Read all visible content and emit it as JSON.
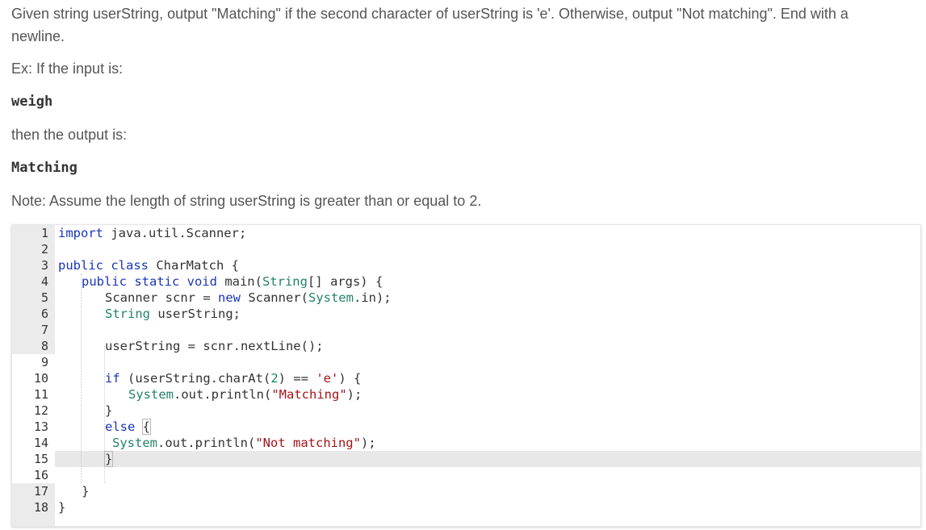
{
  "prompt": {
    "line1": "Given string userString, output \"Matching\" if the second character of userString is 'e'. Otherwise, output \"Not matching\". End with a",
    "line2": "newline.",
    "ex_label": "Ex: If the input is:",
    "example_input": "weigh",
    "then_label": "then the output is:",
    "example_output": "Matching",
    "note": "Note: Assume the length of string userString is greater than or equal to 2."
  },
  "editor": {
    "line_numbers": [
      "1",
      "2",
      "3",
      "4",
      "5",
      "6",
      "7",
      "8",
      "9",
      "10",
      "11",
      "12",
      "13",
      "14",
      "15",
      "16",
      "17",
      "18"
    ],
    "lines": {
      "l1_kw": "import",
      "l1_rest": " java.util.Scanner;",
      "l3_kw": "public class",
      "l3_rest": " CharMatch {",
      "l4_kw": "public static void",
      "l4_main": " main(",
      "l4_type": "String",
      "l4_rest": "[] args) {",
      "l5_a": "Scanner scnr = ",
      "l5_kw": "new",
      "l5_b": " Scanner(",
      "l5_sys": "System",
      "l5_c": ".in);",
      "l6_type": "String",
      "l6_rest": " userString;",
      "l8": "userString = scnr.nextLine();",
      "l10_kw": "if",
      "l10_a": " (userString.charAt(",
      "l10_num": "2",
      "l10_b": ") == ",
      "l10_str": "'e'",
      "l10_c": ") {",
      "l11_sys": "System",
      "l11_a": ".out.println(",
      "l11_str": "\"Matching\"",
      "l11_b": ");",
      "l12": "}",
      "l13_kw": "else",
      "l13_brace": "{",
      "l14_sys": "System",
      "l14_a": ".out.println(",
      "l14_str": "\"Not matching\"",
      "l14_b": ");",
      "l15_brace": "}",
      "l17": "}",
      "l18": "}"
    },
    "colors": {
      "keyword": "#1a36b7",
      "type": "#23826b",
      "string": "#a1151a",
      "number": "#118a5b"
    }
  }
}
